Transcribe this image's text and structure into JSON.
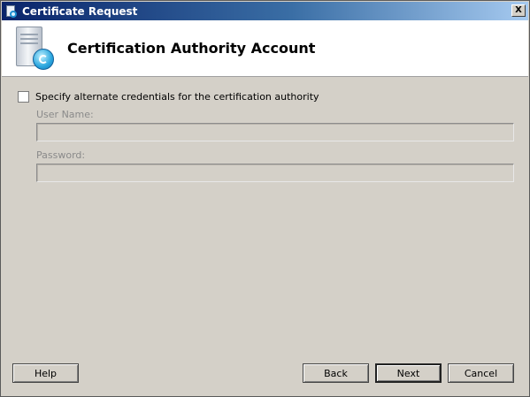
{
  "window": {
    "title": "Certificate Request",
    "close_label": "X"
  },
  "header": {
    "title": "Certification Authority Account",
    "icon": "certificate-server-icon"
  },
  "credentials": {
    "checkbox_label": "Specify alternate credentials for the certification authority",
    "checked": false,
    "username_label": "User Name:",
    "username_value": "",
    "password_label": "Password:",
    "password_value": ""
  },
  "buttons": {
    "help": "Help",
    "back": "Back",
    "next": "Next",
    "cancel": "Cancel"
  },
  "colors": {
    "dialog_bg": "#d4d0c8",
    "header_bg": "#ffffff",
    "disabled_text": "#8a8a8a"
  }
}
